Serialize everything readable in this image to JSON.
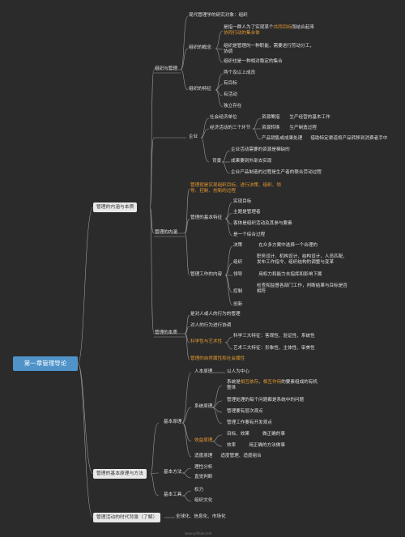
{
  "root": "第一章管理导论",
  "level1": [
    "管理的内涵与本质",
    "管理的基本原理与方法",
    "管理活动的时代背景（了解）"
  ],
  "mgmt_concept": {
    "title": "组织与管理",
    "modern_object": "现代管理学的研究对象：组织",
    "concept_title": "组织的概念",
    "concept_items": [
      "是指一群人为了实现某个",
      "共同目标",
      "而结合起来",
      "协同行动的集合体",
      "组织是管理的一种职能，需要进行劳动分工，",
      "协调",
      "组织也是一种相对稳定的集合"
    ],
    "feature_title": "组织的特征",
    "features": [
      "两个及以上成员",
      "有目标",
      "有活动",
      "独立存在"
    ]
  },
  "enterprise": {
    "title": "企业",
    "unit": "社会经济单位",
    "three_links": "经济活动的三个环节",
    "links": [
      {
        "a": "资源筹措",
        "b": "生产经营的基本工作"
      },
      {
        "a": "资源转换",
        "b": "生产制造过程"
      },
      {
        "a": "产品销售或成果处理",
        "b": "借助特定渠道将产品转移到消费者手中"
      }
    ],
    "bg_title": "背景",
    "bg_items": [
      "企业活动需要的资源是稀缺的",
      "成果要到外部去实现",
      "企业产品制造的过程是生产者的联合劳动过程"
    ]
  },
  "mgmt_content": {
    "title": "管理的内涵",
    "definition": [
      "管理就是实现组织目标，进行决策、组织、领",
      "导、控制、创新的过程"
    ],
    "basic_title": "管理的基本特征",
    "basic_items": [
      "实现目标",
      "主题是管理者",
      "客体是组织活动及其参与要素",
      "是一个综合过程"
    ],
    "work_title": "管理工作的内容",
    "work": [
      {
        "k": "决策",
        "v": "在众多方案中选择一个合理的"
      },
      {
        "k": "组织",
        "v": [
          "职务设计、机构设计、结构设计，人员匹配、",
          "发布工作指令、组织结构的调整与变革"
        ]
      },
      {
        "k": "领导",
        "v": "用权力和能力去指挥和影响下属"
      },
      {
        "k": "控制",
        "v": [
          "检查和监督各部门工作，判断结果与目标是否",
          "相符"
        ]
      },
      {
        "k": "创新",
        "v": ""
      }
    ]
  },
  "mgmt_essence": {
    "title": "管理的本质",
    "items": [
      "是对人或人的行为的管理",
      "对人的行为进行协调"
    ],
    "sci_art_title": "科学性与艺术性",
    "sci": "科学三大特征：客观性、验证性、系统性",
    "art": "艺术三大特征：形象性、主体性、审美性",
    "attr": "管理的自然属性和社会属性"
  },
  "principles": {
    "title": "基本原理",
    "human_title": "人本原理",
    "human_item": "以人为中心",
    "system_title": "系统原理",
    "system_items": [
      "系统是",
      "相互依存",
      "、",
      "相互作用",
      "的要素组成的有机",
      "整体",
      "管理处理的每个问题都是系统中的问题",
      "管理要有层次观点",
      "管理工作要有开发观点"
    ],
    "benefit_title": "效益原理",
    "benefit_items": [
      {
        "k": "目标、效果",
        "v": "做正确的事"
      },
      {
        "k": "效率",
        "v": "用正确的方法做事"
      }
    ],
    "fit_title": "适度原理",
    "fit_item": "适度管理、适度组合"
  },
  "methods": {
    "title": "基本方法",
    "items": [
      "理性分析",
      "直觉判断"
    ]
  },
  "tools": {
    "title": "基本工具",
    "items": [
      "权力",
      "组织文化"
    ]
  },
  "era": "全球化、信息化、市场化",
  "footer": "www.pdfaiw.com"
}
